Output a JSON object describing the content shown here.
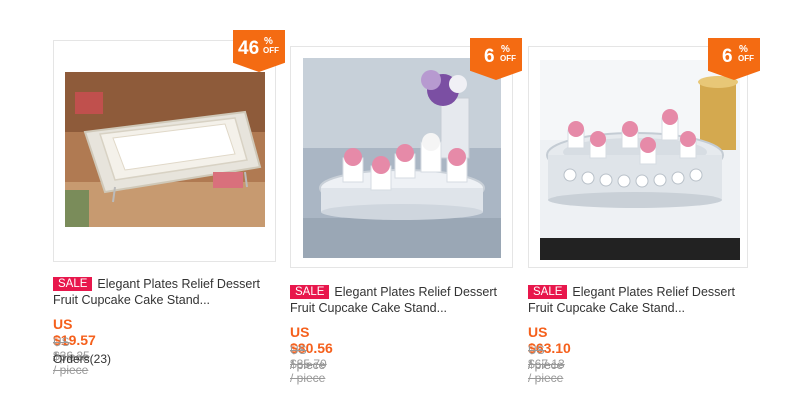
{
  "products": [
    {
      "sale_tag": "SALE",
      "title": "Elegant Plates Relief Dessert Fruit Cupcake Cake Stand...",
      "discount": "46",
      "discount_pct": "%",
      "discount_off": "OFF",
      "price": "US $19.57",
      "unit": " / piece",
      "original_price": "US $36.25 / piece",
      "orders": "Orders(23)"
    },
    {
      "sale_tag": "SALE",
      "title": "Elegant Plates Relief Dessert Fruit Cupcake Cake Stand...",
      "discount": "6",
      "discount_pct": "%",
      "discount_off": "OFF",
      "price": "US $80.56",
      "unit": " / piece",
      "original_price": "US $85.70 / piece"
    },
    {
      "sale_tag": "SALE",
      "title": "Elegant Plates Relief Dessert Fruit Cupcake Cake Stand...",
      "discount": "6",
      "discount_pct": "%",
      "discount_off": "OFF",
      "price": "US $63.10",
      "unit": " / piece",
      "original_price": "US $67.13 / piece"
    }
  ],
  "colors": {
    "discount_badge": "#f46b12",
    "sale_tag": "#e8174c",
    "price": "#f5601c"
  }
}
